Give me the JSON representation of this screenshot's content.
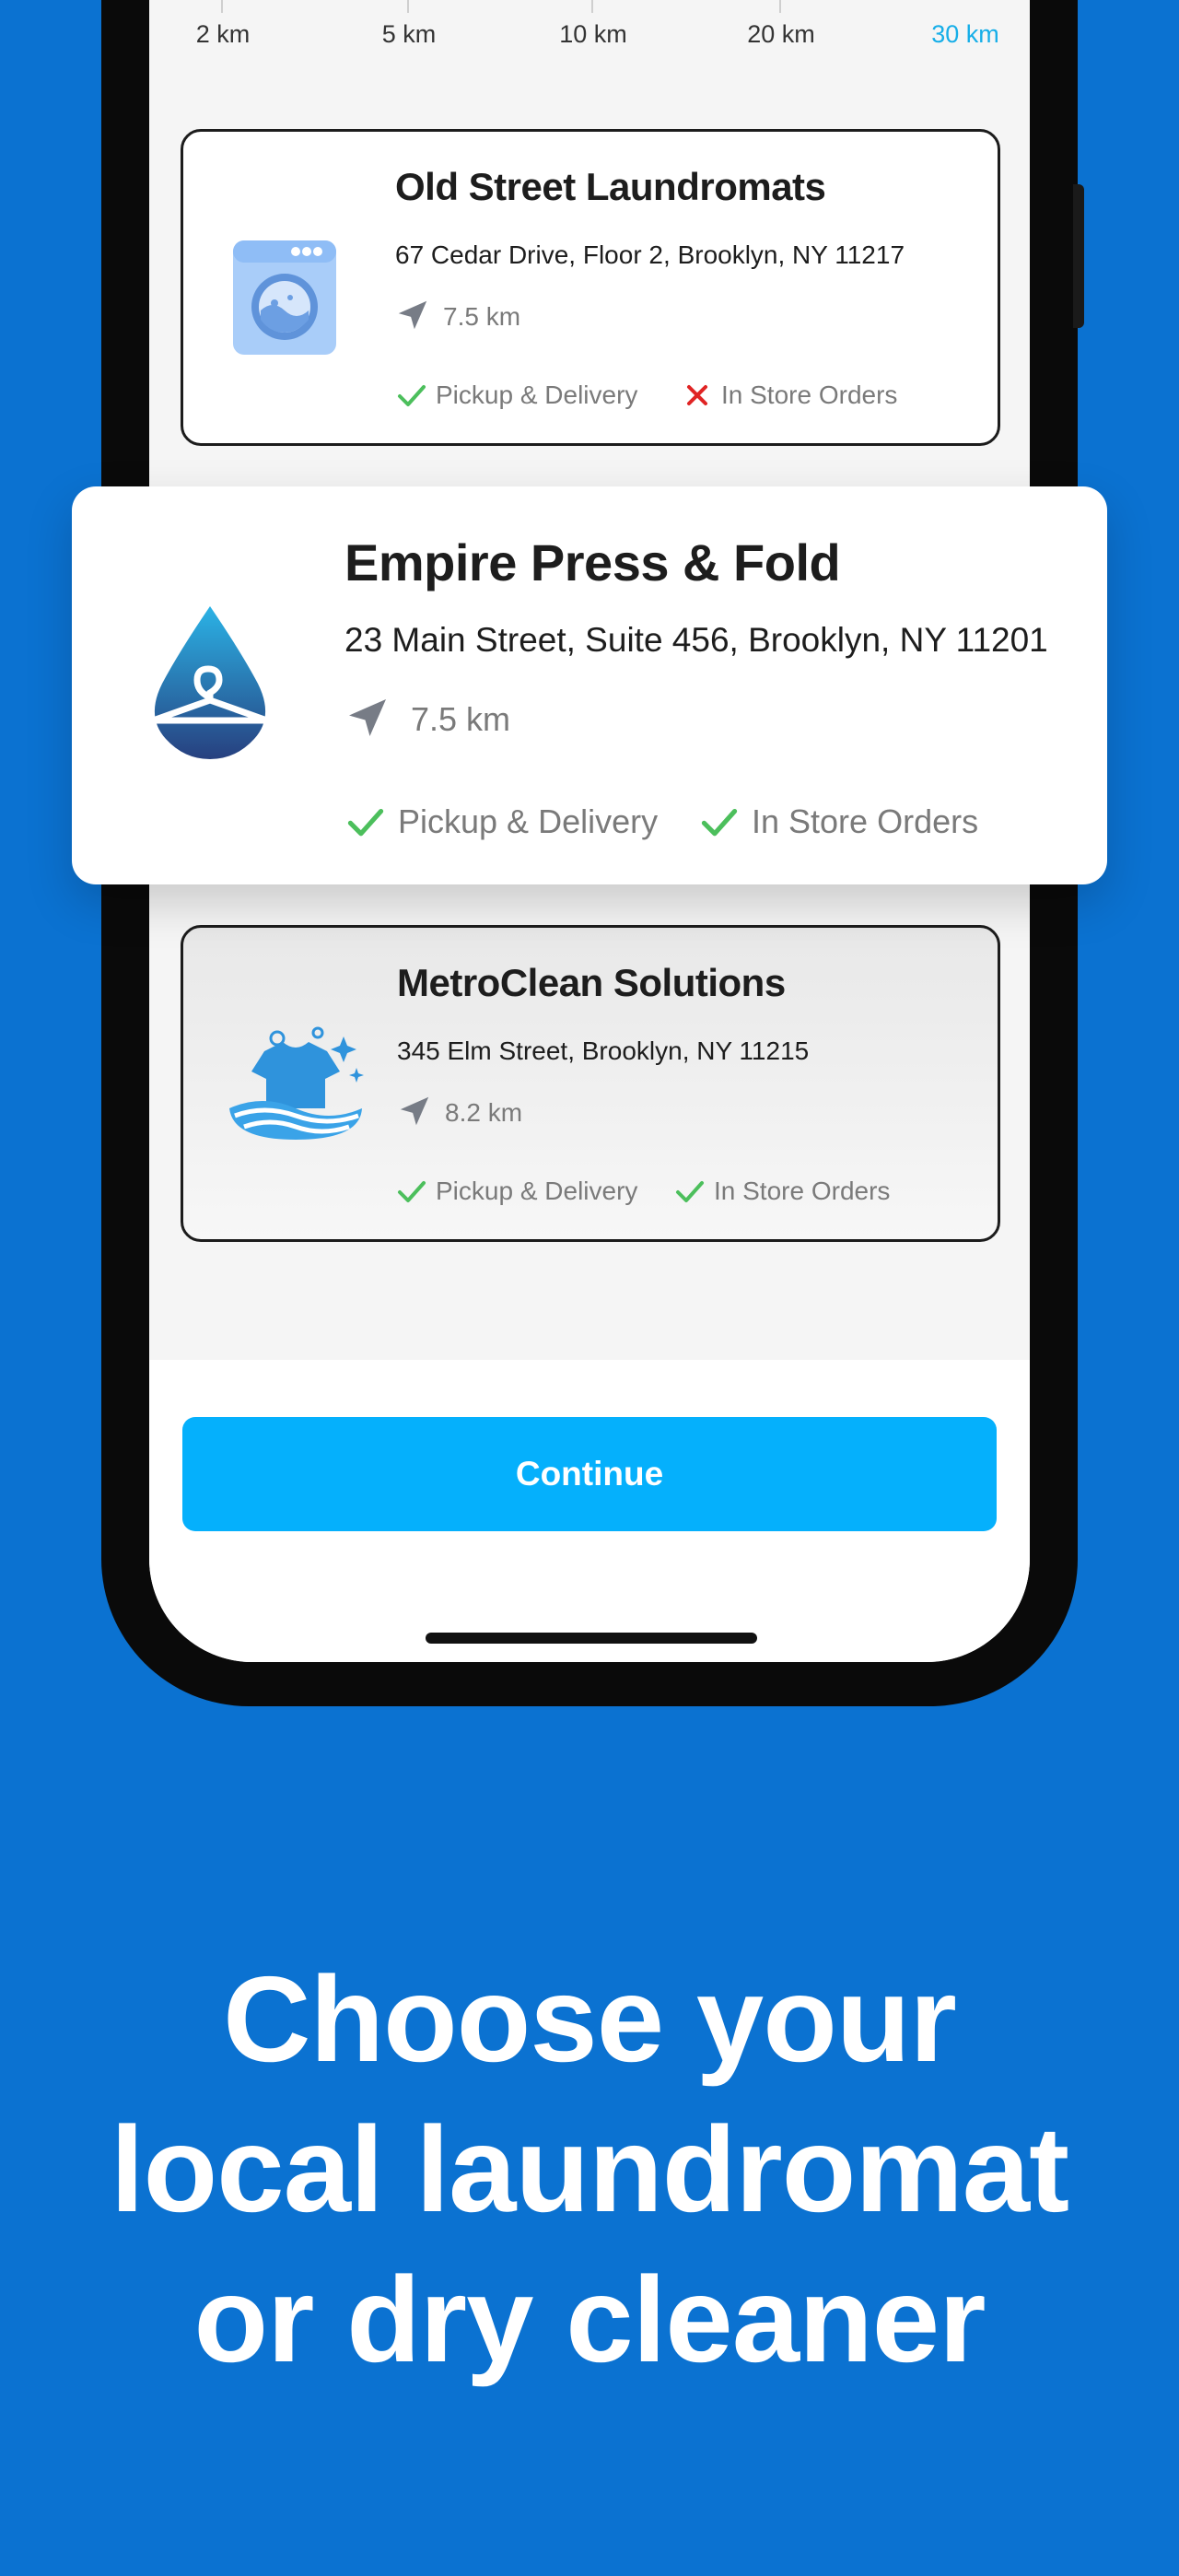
{
  "distance_scale": {
    "options": [
      "2 km",
      "5 km",
      "10 km",
      "20 km",
      "30 km"
    ],
    "selected": "30 km",
    "accent_color": "#16aee8"
  },
  "laundromats": [
    {
      "name": "Old Street Laundromats",
      "address": "67 Cedar Drive, Floor 2, Brooklyn, NY 11217",
      "distance": "7.5 km",
      "logo": "washing-machine-icon",
      "features": [
        {
          "label": "Pickup & Delivery",
          "available": true
        },
        {
          "label": "In Store Orders",
          "available": false
        }
      ]
    },
    {
      "name": "Empire Press & Fold",
      "address": "23 Main Street, Suite 456, Brooklyn, NY 11201",
      "distance": "7.5 km",
      "logo": "water-drop-hanger-icon",
      "highlighted": true,
      "features": [
        {
          "label": "Pickup & Delivery",
          "available": true
        },
        {
          "label": "In Store Orders",
          "available": true
        }
      ]
    },
    {
      "name": "MetroClean Solutions",
      "address": "345 Elm Street, Brooklyn, NY 11215",
      "distance": "8.2 km",
      "logo": "shirt-waves-icon",
      "features": [
        {
          "label": "Pickup & Delivery",
          "available": true
        },
        {
          "label": "In Store Orders",
          "available": true
        }
      ]
    }
  ],
  "continue_button": {
    "label": "Continue",
    "color": "#05b0fc"
  },
  "headline": {
    "lines": [
      "Choose your",
      "local laundromat",
      "or dry cleaner"
    ]
  },
  "colors": {
    "background": "#0b72d1",
    "check": "#4cbf5c",
    "cross": "#e02424"
  }
}
